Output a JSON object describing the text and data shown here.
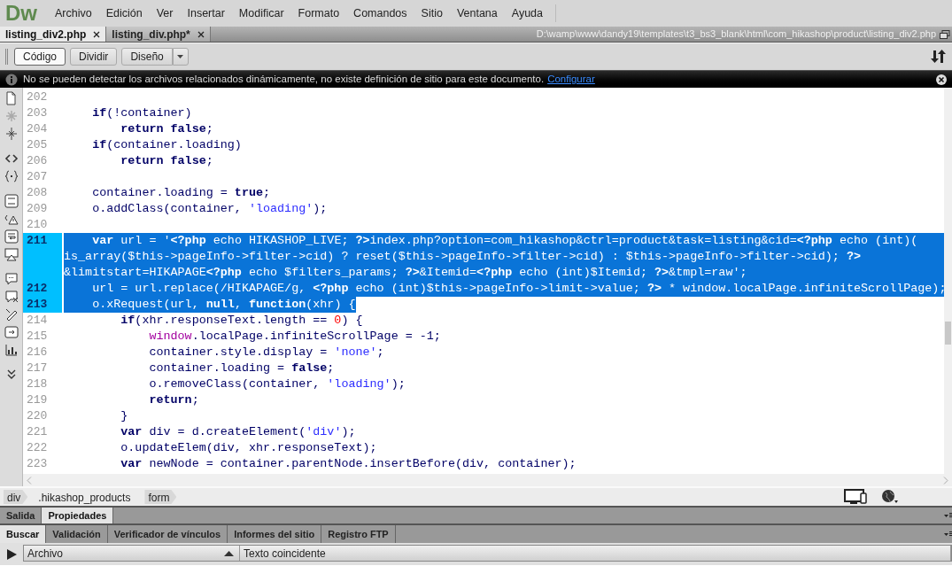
{
  "menu_bar": {
    "logo": "Dw",
    "items": [
      "Archivo",
      "Edición",
      "Ver",
      "Insertar",
      "Modificar",
      "Formato",
      "Comandos",
      "Sitio",
      "Ventana",
      "Ayuda"
    ]
  },
  "document_tabs": [
    {
      "label": "listing_div2.php",
      "selected": true
    },
    {
      "label": "listing_div.php*",
      "selected": false
    }
  ],
  "file_path": "D:\\wamp\\www\\dandy19\\templates\\t3_bs3_blank\\html\\com_hikashop\\product\\listing_div2.php",
  "view_buttons": [
    {
      "label": "Código",
      "selected": true
    },
    {
      "label": "Dividir",
      "selected": false
    },
    {
      "label": "Diseño",
      "selected": false
    }
  ],
  "info_bar": {
    "message": "No se pueden detectar los archivos relacionados dinámicamente, no existe definición de sitio para este documento.",
    "link": "Configurar"
  },
  "code_lines": [
    {
      "number": "202",
      "selected": false
    },
    {
      "number": "203",
      "selected": false,
      "tokens": [
        {
          "kind": "keyword",
          "text": "    if"
        },
        {
          "kind": "plain",
          "text": "(!container)"
        }
      ]
    },
    {
      "number": "204",
      "selected": false,
      "tokens": [
        {
          "kind": "keyword",
          "text": "        return false"
        },
        {
          "kind": "plain",
          "text": ";"
        }
      ]
    },
    {
      "number": "205",
      "selected": false,
      "tokens": [
        {
          "kind": "keyword",
          "text": "    if"
        },
        {
          "kind": "plain",
          "text": "(container.loading)"
        }
      ]
    },
    {
      "number": "206",
      "selected": false,
      "tokens": [
        {
          "kind": "keyword",
          "text": "        return false"
        },
        {
          "kind": "plain",
          "text": ";"
        }
      ]
    },
    {
      "number": "207",
      "selected": false
    },
    {
      "number": "208",
      "selected": false,
      "tokens": [
        {
          "kind": "plain",
          "text": "    container.loading = "
        },
        {
          "kind": "keyword",
          "text": "true"
        },
        {
          "kind": "plain",
          "text": ";"
        }
      ]
    },
    {
      "number": "209",
      "selected": false,
      "tokens": [
        {
          "kind": "plain",
          "text": "    o.addClass(container, "
        },
        {
          "kind": "string",
          "text": "'loading'"
        },
        {
          "kind": "plain",
          "text": ");"
        }
      ]
    },
    {
      "number": "210",
      "selected": false
    },
    {
      "number": "211",
      "selected": true,
      "tokens": [
        {
          "kind": "keyword",
          "text": "    var"
        },
        {
          "kind": "plain",
          "text": " url = '"
        },
        {
          "kind": "php",
          "text": "<?php"
        },
        {
          "kind": "plain",
          "text": " echo HIKASHOP_LIVE; "
        },
        {
          "kind": "php",
          "text": "?>"
        },
        {
          "kind": "plain",
          "text": "index.php?option=com_hikashop&ctrl=product&task=listing&cid="
        },
        {
          "kind": "php",
          "text": "<?php"
        },
        {
          "kind": "plain",
          "text": " echo (int)("
        }
      ]
    },
    {
      "selected": true,
      "tokens": [
        {
          "kind": "plain",
          "text": "is_array($this->pageInfo->filter->cid) ? reset($this->pageInfo->filter->cid) : $this->pageInfo->filter->cid); "
        },
        {
          "kind": "php",
          "text": "?>"
        }
      ]
    },
    {
      "selected": true,
      "tokens": [
        {
          "kind": "plain",
          "text": "&limitstart=HIKAPAGE"
        },
        {
          "kind": "php",
          "text": "<?php"
        },
        {
          "kind": "plain",
          "text": " echo $filters_params; "
        },
        {
          "kind": "php",
          "text": "?>"
        },
        {
          "kind": "plain",
          "text": "&Itemid="
        },
        {
          "kind": "php",
          "text": "<?php"
        },
        {
          "kind": "plain",
          "text": " echo (int)$Itemid; "
        },
        {
          "kind": "php",
          "text": "?>"
        },
        {
          "kind": "plain",
          "text": "&tmpl=raw';"
        }
      ]
    },
    {
      "number": "212",
      "selected": true,
      "tokens": [
        {
          "kind": "plain",
          "text": "    url = url.replace(/HIKAPAGE/g, "
        },
        {
          "kind": "php",
          "text": "<?php"
        },
        {
          "kind": "plain",
          "text": " echo (int)$this->pageInfo->limit->value; "
        },
        {
          "kind": "php",
          "text": "?>"
        },
        {
          "kind": "plain",
          "text": " * window.localPage.infiniteScrollPage);"
        }
      ]
    },
    {
      "number": "213",
      "selected": true,
      "tokens": [
        {
          "kind": "plain",
          "text": "    o.xRequest(url, "
        },
        {
          "kind": "keyword",
          "text": "null"
        },
        {
          "kind": "plain",
          "text": ", "
        },
        {
          "kind": "keyword",
          "text": "function"
        },
        {
          "kind": "plain",
          "text": "(xhr) {"
        }
      ]
    },
    {
      "number": "214",
      "selected": false,
      "tokens": [
        {
          "kind": "keyword",
          "text": "        if"
        },
        {
          "kind": "plain",
          "text": "(xhr.responseText.length == "
        },
        {
          "kind": "number",
          "text": "0"
        },
        {
          "kind": "plain",
          "text": ") {"
        }
      ]
    },
    {
      "number": "215",
      "selected": false,
      "tokens": [
        {
          "kind": "object",
          "text": "            window"
        },
        {
          "kind": "plain",
          "text": ".localPage.infiniteScrollPage = -1;"
        }
      ]
    },
    {
      "number": "216",
      "selected": false,
      "tokens": [
        {
          "kind": "plain",
          "text": "            container.style.display = "
        },
        {
          "kind": "string",
          "text": "'none'"
        },
        {
          "kind": "plain",
          "text": ";"
        }
      ]
    },
    {
      "number": "217",
      "selected": false,
      "tokens": [
        {
          "kind": "plain",
          "text": "            container.loading = "
        },
        {
          "kind": "keyword",
          "text": "false"
        },
        {
          "kind": "plain",
          "text": ";"
        }
      ]
    },
    {
      "number": "218",
      "selected": false,
      "tokens": [
        {
          "kind": "plain",
          "text": "            o.removeClass(container, "
        },
        {
          "kind": "string",
          "text": "'loading'"
        },
        {
          "kind": "plain",
          "text": ");"
        }
      ]
    },
    {
      "number": "219",
      "selected": false,
      "tokens": [
        {
          "kind": "keyword",
          "text": "            return"
        },
        {
          "kind": "plain",
          "text": ";"
        }
      ]
    },
    {
      "number": "220",
      "selected": false,
      "tokens": [
        {
          "kind": "plain",
          "text": "        }"
        }
      ]
    },
    {
      "number": "221",
      "selected": false,
      "tokens": [
        {
          "kind": "keyword",
          "text": "        var"
        },
        {
          "kind": "plain",
          "text": " div = d.createElement("
        },
        {
          "kind": "string",
          "text": "'div'"
        },
        {
          "kind": "plain",
          "text": ");"
        }
      ]
    },
    {
      "number": "222",
      "selected": false,
      "tokens": [
        {
          "kind": "plain",
          "text": "        o.updateElem(div, xhr.responseText);"
        }
      ]
    },
    {
      "number": "223",
      "selected": false,
      "tokens": [
        {
          "kind": "keyword",
          "text": "        var"
        },
        {
          "kind": "plain",
          "text": " newNode = container.parentNode.insertBefore(div, container);"
        }
      ]
    }
  ],
  "tag_selector": [
    "div",
    ".hikashop_products",
    "form"
  ],
  "panel_tabs": [
    {
      "label": "Salida",
      "selected": false
    },
    {
      "label": "Propiedades",
      "selected": true
    }
  ],
  "search_tabs": [
    {
      "label": "Buscar",
      "selected": true
    },
    {
      "label": "Validación",
      "selected": false
    },
    {
      "label": "Verificador de vínculos",
      "selected": false
    },
    {
      "label": "Informes del sitio",
      "selected": false
    },
    {
      "label": "Registro FTP",
      "selected": false
    }
  ],
  "results_columns": [
    "Archivo",
    "Texto coincidente"
  ]
}
